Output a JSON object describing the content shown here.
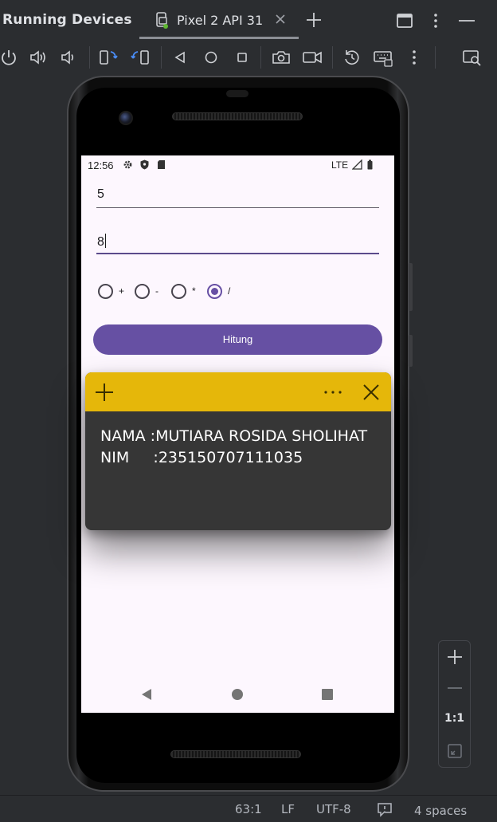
{
  "ide": {
    "tool_window_title": "Running Devices",
    "tab_label": "Pixel 2 API 31",
    "icons": {
      "device": "device-mirror-icon",
      "close": "close-icon",
      "add": "plus-icon",
      "layout": "window-layout-icon",
      "more": "more-vertical-icon",
      "minimize": "minimize-icon"
    }
  },
  "toolbar": {
    "icons": [
      "power-icon",
      "volume-up-icon",
      "volume-down-icon",
      "rotate-left-icon",
      "rotate-right-icon",
      "back-icon",
      "home-icon",
      "overview-icon",
      "screenshot-icon",
      "screen-record-icon",
      "reset-icon",
      "keyboard-icon",
      "more-vertical-icon",
      "device-explorer-icon"
    ]
  },
  "device": {
    "status_bar": {
      "time": "12:56",
      "network": "LTE",
      "icons": [
        "settings-icon",
        "shield-icon",
        "sd-card-icon",
        "signal-icon",
        "battery-icon"
      ]
    },
    "inputs": [
      {
        "value": "5"
      },
      {
        "value": "8"
      }
    ],
    "operators": [
      {
        "label": "+",
        "checked": false
      },
      {
        "label": "-",
        "checked": false
      },
      {
        "label": "*",
        "checked": false
      },
      {
        "label": "/",
        "checked": true
      }
    ],
    "button_label": "Hitung",
    "nav": [
      "back-triangle-icon",
      "home-circle-icon",
      "recents-square-icon"
    ]
  },
  "sticky_note": {
    "header_color": "#e5b70a",
    "body_color": "#363636",
    "rows": [
      {
        "key": "NAMA",
        "sep": " :",
        "value": "MUTIARA ROSIDA SHOLIHAT"
      },
      {
        "key": "NIM",
        "sep": "     :",
        "value": "235150707111035"
      }
    ]
  },
  "zoom": {
    "actual_size_label": "1:1"
  },
  "status_bar": {
    "position": "63:1",
    "line_ending": "LF",
    "encoding": "UTF-8",
    "indent": "4 spaces"
  },
  "colors": {
    "accent": "#6650a3",
    "ide_background": "#2b2d30",
    "screen_background": "#fdf7fe"
  }
}
